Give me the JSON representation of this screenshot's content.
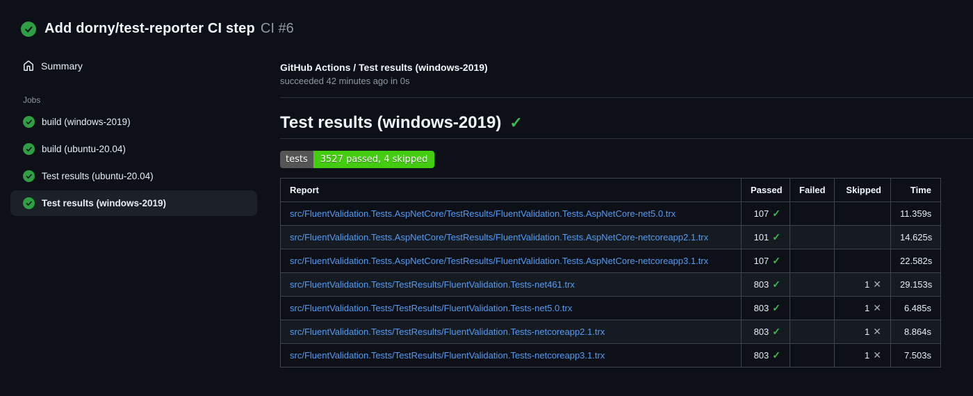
{
  "header": {
    "title": "Add dorny/test-reporter CI step",
    "run_number": "CI #6",
    "status": "success"
  },
  "sidebar": {
    "summary_label": "Summary",
    "jobs_label": "Jobs",
    "jobs": [
      {
        "label": "build (windows-2019)",
        "status": "success",
        "selected": false
      },
      {
        "label": "build (ubuntu-20.04)",
        "status": "success",
        "selected": false
      },
      {
        "label": "Test results (ubuntu-20.04)",
        "status": "success",
        "selected": false
      },
      {
        "label": "Test results (windows-2019)",
        "status": "success",
        "selected": true
      }
    ]
  },
  "main": {
    "check_title": "GitHub Actions / Test results (windows-2019)",
    "check_status": "succeeded 42 minutes ago in 0s",
    "heading": "Test results (windows-2019)",
    "heading_check": "✓",
    "badge": {
      "label": "tests",
      "value": "3527 passed, 4 skipped"
    },
    "table": {
      "columns": [
        "Report",
        "Passed",
        "Failed",
        "Skipped",
        "Time"
      ],
      "rows": [
        {
          "report": "src/FluentValidation.Tests.AspNetCore/TestResults/FluentValidation.Tests.AspNetCore-net5.0.trx",
          "passed": "107",
          "failed": "",
          "skipped": "",
          "time": "11.359s"
        },
        {
          "report": "src/FluentValidation.Tests.AspNetCore/TestResults/FluentValidation.Tests.AspNetCore-netcoreapp2.1.trx",
          "passed": "101",
          "failed": "",
          "skipped": "",
          "time": "14.625s"
        },
        {
          "report": "src/FluentValidation.Tests.AspNetCore/TestResults/FluentValidation.Tests.AspNetCore-netcoreapp3.1.trx",
          "passed": "107",
          "failed": "",
          "skipped": "",
          "time": "22.582s"
        },
        {
          "report": "src/FluentValidation.Tests/TestResults/FluentValidation.Tests-net461.trx",
          "passed": "803",
          "failed": "",
          "skipped": "1",
          "time": "29.153s"
        },
        {
          "report": "src/FluentValidation.Tests/TestResults/FluentValidation.Tests-net5.0.trx",
          "passed": "803",
          "failed": "",
          "skipped": "1",
          "time": "6.485s"
        },
        {
          "report": "src/FluentValidation.Tests/TestResults/FluentValidation.Tests-netcoreapp2.1.trx",
          "passed": "803",
          "failed": "",
          "skipped": "1",
          "time": "8.864s"
        },
        {
          "report": "src/FluentValidation.Tests/TestResults/FluentValidation.Tests-netcoreapp3.1.trx",
          "passed": "803",
          "failed": "",
          "skipped": "1",
          "time": "7.503s"
        }
      ]
    }
  },
  "icons": {
    "passed": "✓",
    "skipped": "✕"
  },
  "colors": {
    "page-bg": "#0d1117",
    "row-alt-bg": "#161b22",
    "border": "#3d444d",
    "divider": "#2b313a",
    "text-primary": "#e6edf3",
    "text-muted": "#9198a1",
    "link": "#539bf5",
    "success-green": "#2ea043",
    "check-green": "#3fb950",
    "x-gray": "#a8b0b9",
    "badge-label-bg": "#555555",
    "badge-value-bg": "#44cc11",
    "selected-bg": "#1c2127"
  }
}
